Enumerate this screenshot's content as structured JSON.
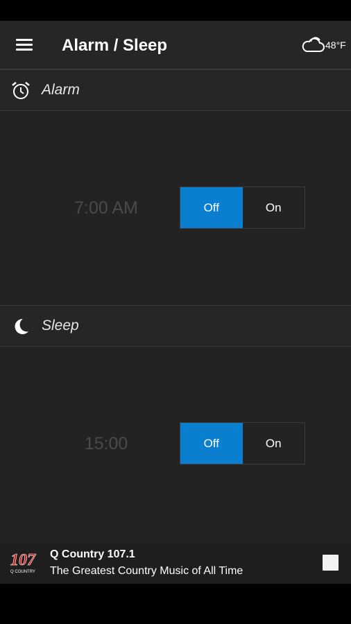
{
  "app": {
    "title": "Alarm / Sleep"
  },
  "weather": {
    "icon": "cloud-icon",
    "temp": "48°F"
  },
  "alarm": {
    "title": "Alarm",
    "icon": "alarm-clock-icon",
    "time": "7:00 AM",
    "off_label": "Off",
    "on_label": "On",
    "state": "Off"
  },
  "sleep": {
    "title": "Sleep",
    "icon": "moon-icon",
    "time": "15:00",
    "off_label": "Off",
    "on_label": "On",
    "state": "Off"
  },
  "now_playing": {
    "logo_text": "107",
    "logo_subtext": "Q COUNTRY",
    "station": "Q Country 107.1",
    "tagline": "The Greatest Country Music of All Time"
  },
  "colors": {
    "accent": "#0a7fd0",
    "background": "#232323",
    "header": "#262626"
  }
}
